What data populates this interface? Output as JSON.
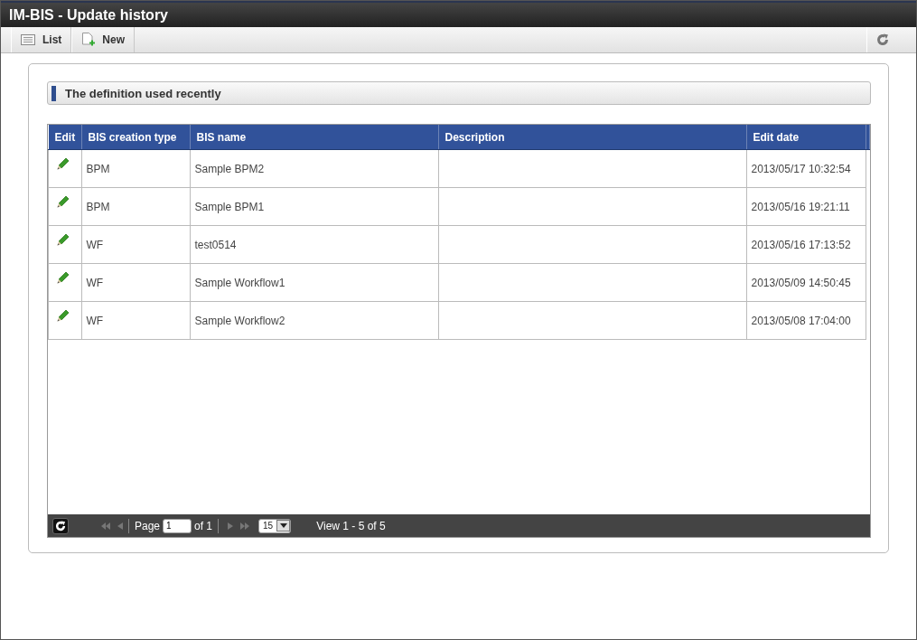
{
  "window": {
    "title": "IM-BIS - Update history"
  },
  "toolbar": {
    "buttons": [
      {
        "label": "List",
        "kind": "list"
      },
      {
        "label": "New",
        "kind": "new"
      }
    ]
  },
  "section": {
    "title": "The definition used recently"
  },
  "table": {
    "columns": [
      "Edit",
      "BIS creation type",
      "BIS name",
      "Description",
      "Edit date"
    ],
    "rows": [
      {
        "type": "BPM",
        "name": "Sample BPM2",
        "description": "",
        "date": "2013/05/17 10:32:54"
      },
      {
        "type": "BPM",
        "name": "Sample BPM1",
        "description": "",
        "date": "2013/05/16 19:21:11"
      },
      {
        "type": "WF",
        "name": "test0514",
        "description": "",
        "date": "2013/05/16 17:13:52"
      },
      {
        "type": "WF",
        "name": "Sample Workflow1",
        "description": "",
        "date": "2013/05/09 14:50:45"
      },
      {
        "type": "WF",
        "name": "Sample Workflow2",
        "description": "",
        "date": "2013/05/08 17:04:00"
      }
    ]
  },
  "pager": {
    "page_label": "Page",
    "page": "1",
    "of": "of 1",
    "page_size": "15",
    "view": "View 1 - 5 of 5"
  }
}
